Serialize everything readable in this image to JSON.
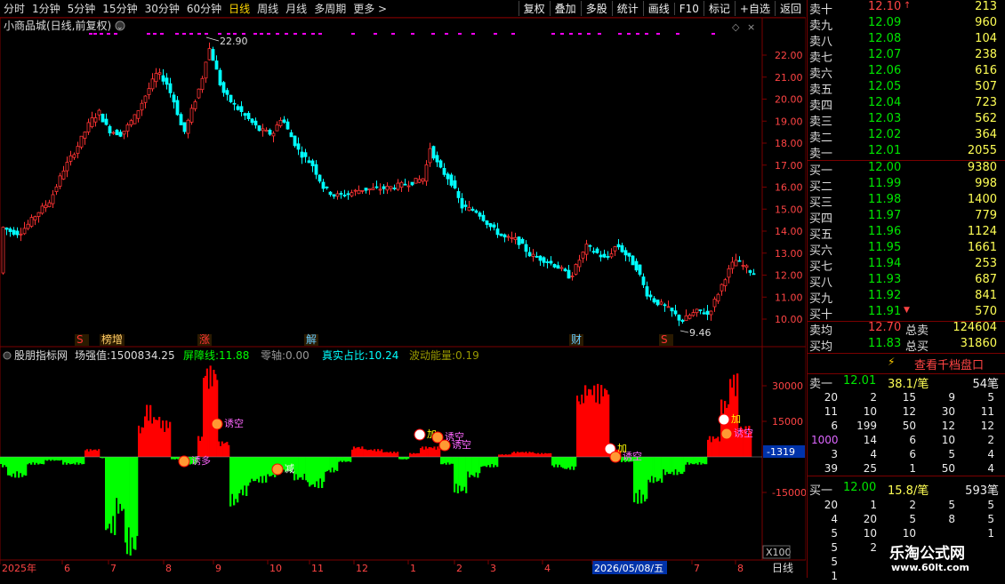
{
  "toolbar": {
    "periods": [
      "分时",
      "1分钟",
      "5分钟",
      "15分钟",
      "30分钟",
      "60分钟",
      "日线",
      "周线",
      "月线",
      "多周期",
      "更多 >"
    ],
    "active": "日线",
    "buttons": [
      "复权",
      "叠加",
      "多股",
      "统计",
      "画线",
      "F10",
      "标记",
      "+自选",
      "返回"
    ]
  },
  "title": "小商品城(日线,前复权)",
  "price_axis": [
    "22.00",
    "21.00",
    "20.00",
    "19.00",
    "18.00",
    "17.00",
    "16.00",
    "15.00",
    "14.00",
    "13.00",
    "12.00",
    "11.00",
    "10.00"
  ],
  "high_label": "22.90",
  "low_label": "9.46",
  "events": [
    {
      "text": "S",
      "color": "#ff3333"
    },
    {
      "text": "榜增",
      "color": "#ffcc66"
    },
    {
      "text": "涨",
      "color": "#ff3333"
    },
    {
      "text": "解",
      "color": "#66ccff"
    },
    {
      "text": "财",
      "color": "#66ccff"
    },
    {
      "text": "S",
      "color": "#ff3333"
    }
  ],
  "indicator": {
    "name": "股朋指标网",
    "items": [
      {
        "label": "场强值:",
        "value": "1500834.25",
        "color": "#dddddd"
      },
      {
        "label": "屏障线:",
        "value": "11.88",
        "color": "#00ff00"
      },
      {
        "label": "零轴:",
        "value": "0.00",
        "color": "#999999"
      },
      {
        "label": "真实占比:",
        "value": "10.24",
        "color": "#00ffff"
      },
      {
        "label": "波动能量:",
        "value": "0.19",
        "color": "#999900"
      }
    ],
    "axis": [
      "30000",
      "15000",
      "-15000"
    ],
    "current": "-1319",
    "scale": "X100",
    "signals": [
      "诱空",
      "诱多",
      "减",
      "加",
      "诱空",
      "诱空",
      "加",
      "诱空",
      "加",
      "诱空"
    ]
  },
  "date_axis": [
    "2025年",
    "6",
    "7",
    "8",
    "9",
    "10",
    "11",
    "12",
    "1",
    "2",
    "3",
    "4",
    "2026/05/08/五",
    "7",
    "8"
  ],
  "period_label": "日线",
  "orderbook": {
    "sell": [
      {
        "label": "卖十",
        "price": "12.10",
        "vol": "213"
      },
      {
        "label": "卖九",
        "price": "12.09",
        "vol": "960"
      },
      {
        "label": "卖八",
        "price": "12.08",
        "vol": "104"
      },
      {
        "label": "卖七",
        "price": "12.07",
        "vol": "238"
      },
      {
        "label": "卖六",
        "price": "12.06",
        "vol": "616"
      },
      {
        "label": "卖五",
        "price": "12.05",
        "vol": "507"
      },
      {
        "label": "卖四",
        "price": "12.04",
        "vol": "723"
      },
      {
        "label": "卖三",
        "price": "12.03",
        "vol": "562"
      },
      {
        "label": "卖二",
        "price": "12.02",
        "vol": "364"
      },
      {
        "label": "卖一",
        "price": "12.01",
        "vol": "2055"
      }
    ],
    "buy": [
      {
        "label": "买一",
        "price": "12.00",
        "vol": "9380"
      },
      {
        "label": "买二",
        "price": "11.99",
        "vol": "998"
      },
      {
        "label": "买三",
        "price": "11.98",
        "vol": "1400"
      },
      {
        "label": "买四",
        "price": "11.97",
        "vol": "779"
      },
      {
        "label": "买五",
        "price": "11.96",
        "vol": "1124"
      },
      {
        "label": "买六",
        "price": "11.95",
        "vol": "1661"
      },
      {
        "label": "买七",
        "price": "11.94",
        "vol": "253"
      },
      {
        "label": "买八",
        "price": "11.93",
        "vol": "687"
      },
      {
        "label": "买九",
        "price": "11.92",
        "vol": "841"
      },
      {
        "label": "买十",
        "price": "11.91",
        "vol": "570"
      }
    ],
    "avg_sell_label": "卖均",
    "avg_sell": "12.70",
    "total_sell_label": "总卖",
    "total_sell": "124604",
    "avg_buy_label": "买均",
    "avg_buy": "11.83",
    "total_buy_label": "总买",
    "total_buy": "31860",
    "detail_button": "查看千档盘口",
    "sell1": {
      "label": "卖一",
      "price": "12.01",
      "per": "38.1/笔",
      "count": "54笔"
    },
    "sell_grid": [
      [
        "20",
        "2",
        "15",
        "9",
        "5"
      ],
      [
        "11",
        "10",
        "12",
        "30",
        "11"
      ],
      [
        "6",
        "199",
        "50",
        "12",
        "12"
      ],
      [
        "1000",
        "14",
        "6",
        "10",
        "2"
      ],
      [
        "3",
        "4",
        "6",
        "5",
        "4"
      ],
      [
        "39",
        "25",
        "1",
        "50",
        "4"
      ]
    ],
    "buy1": {
      "label": "买一",
      "price": "12.00",
      "per": "15.8/笔",
      "count": "593笔"
    },
    "buy_grid": [
      [
        "20",
        "1",
        "2",
        "5",
        "5"
      ],
      [
        "4",
        "20",
        "5",
        "8",
        "5"
      ],
      [
        "5",
        "10",
        "10",
        "",
        "1"
      ],
      [
        "5",
        "2",
        "",
        "",
        ""
      ],
      [
        "5",
        "",
        "",
        "",
        ""
      ],
      [
        "1",
        "",
        "",
        "",
        ""
      ]
    ]
  },
  "watermark": {
    "line1": "乐淘公式网",
    "line2": "www.60lt.com"
  }
}
